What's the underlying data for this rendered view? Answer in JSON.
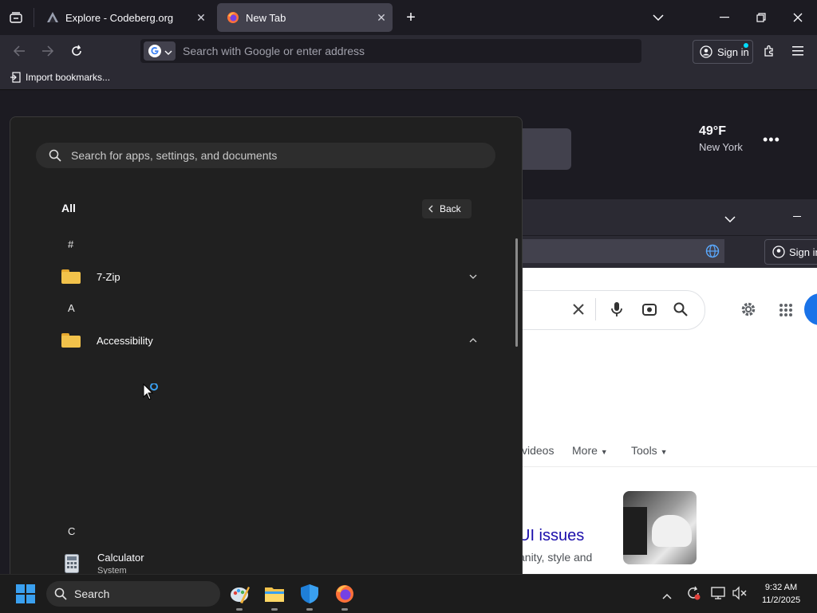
{
  "browser": {
    "tabs": [
      {
        "title": "Explore - Codeberg.org",
        "active": false
      },
      {
        "title": "New Tab",
        "active": true
      }
    ],
    "urlbar_placeholder": "Search with Google or enter address",
    "sign_in_label": "Sign in",
    "bookmarks_import_label": "Import bookmarks..."
  },
  "background_page": {
    "weather": {
      "temp": "49°F",
      "city": "New York"
    },
    "inner_sign_in": "Sign in",
    "google_tabs": [
      "videos",
      "More",
      "Tools"
    ],
    "result_title": "UI issues",
    "result_snippet": "anity, style and"
  },
  "start_menu": {
    "search_placeholder": "Search for apps, settings, and documents",
    "heading": "All",
    "back_label": "Back",
    "letters": {
      "hash": "#",
      "a": "A",
      "c": "C"
    },
    "apps": {
      "seven_zip": "7-Zip",
      "accessibility": "Accessibility",
      "calculator": "Calculator",
      "calculator_sub": "System"
    }
  },
  "taskbar": {
    "search_label": "Search",
    "time": "9:32 AM",
    "date": "11/2/2025"
  },
  "colors": {
    "google_blue": "#1a73e8",
    "link_color": "#1a0dab",
    "folder_yellow": "#f2c24b",
    "windows_blue": "#3aa0f0"
  }
}
